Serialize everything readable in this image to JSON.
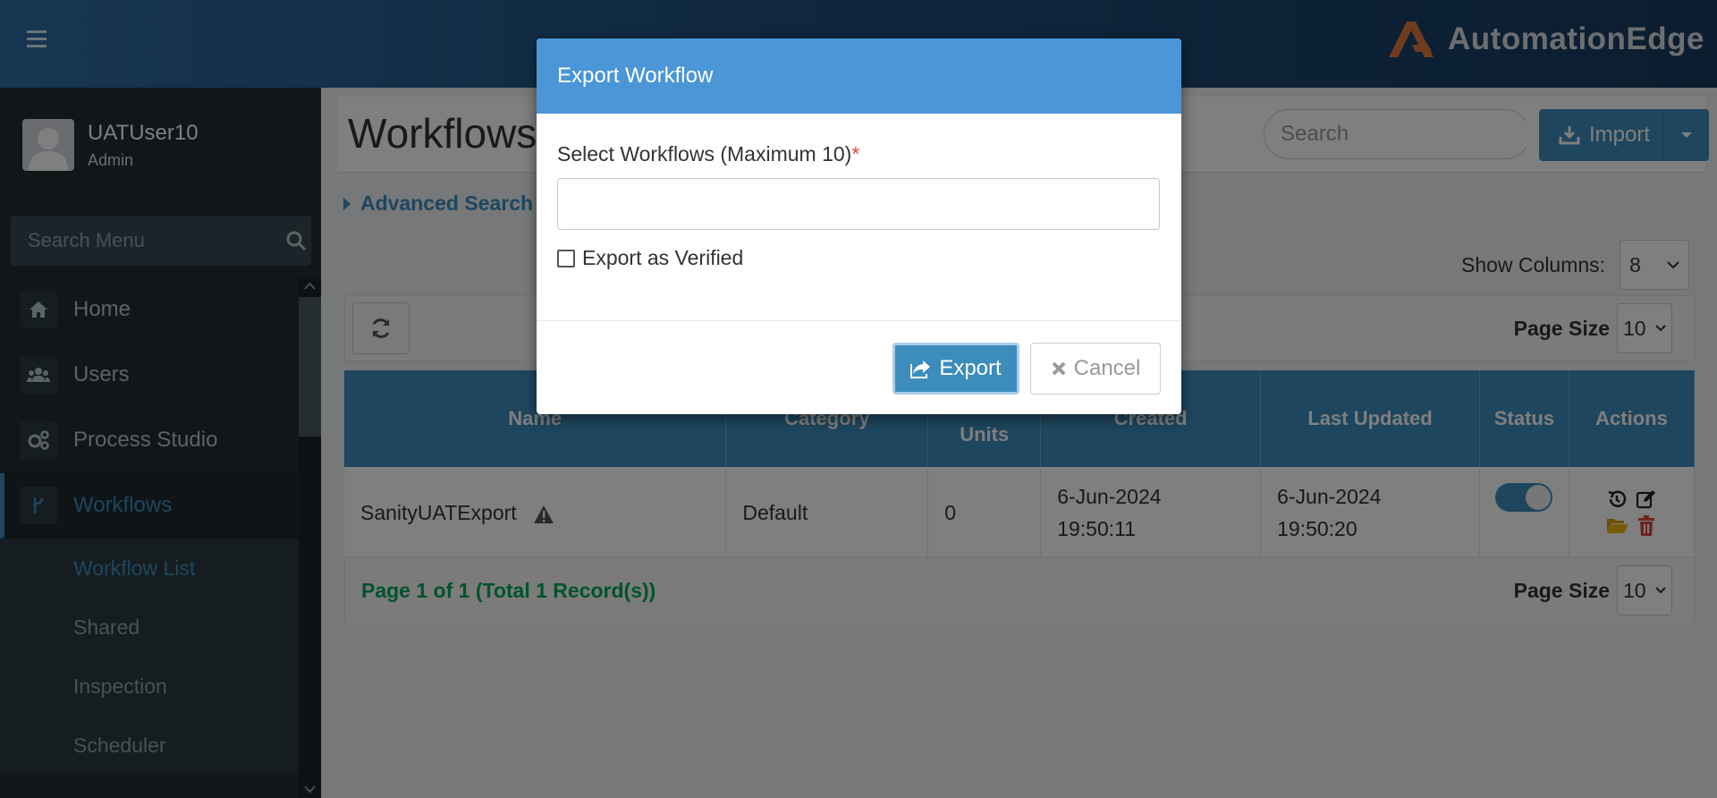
{
  "header": {
    "brand": "AutomationEdge"
  },
  "sidebar": {
    "user_name": "UATUser10",
    "user_role": "Admin",
    "search_placeholder": "Search Menu",
    "items": [
      {
        "label": "Home",
        "icon": "home-icon"
      },
      {
        "label": "Users",
        "icon": "users-icon"
      },
      {
        "label": "Process Studio",
        "icon": "gears-icon"
      },
      {
        "label": "Workflows",
        "icon": "workflow-icon"
      }
    ],
    "subitems": [
      {
        "label": "Workflow List"
      },
      {
        "label": "Shared"
      },
      {
        "label": "Inspection"
      },
      {
        "label": "Scheduler"
      }
    ]
  },
  "page": {
    "title": "Workflows",
    "search_placeholder": "Search",
    "import_label": "Import",
    "advanced_search": "Advanced Search",
    "show_columns_label": "Show Columns:",
    "show_columns_value": "8",
    "page_size_label": "Page Size",
    "page_size_value": "10"
  },
  "table": {
    "columns": [
      "Name",
      "Category",
      "Units",
      "Created",
      "Last Updated",
      "Status",
      "Actions"
    ],
    "rows": [
      {
        "name": "SanityUATExport",
        "category": "Default",
        "units": "0",
        "created_date": "6-Jun-2024",
        "created_time": "19:50:11",
        "updated_date": "6-Jun-2024",
        "updated_time": "19:50:20",
        "status_enabled": true
      }
    ],
    "page_info": "Page 1 of 1 (Total 1 Record(s))"
  },
  "modal": {
    "title": "Export Workflow",
    "select_label": "Select Workflows (Maximum 10)",
    "required_mark": "*",
    "workflows_value": "",
    "export_verified_label": "Export as Verified",
    "export_label": "Export",
    "cancel_label": "Cancel"
  },
  "colors": {
    "primary": "#3c8dbc",
    "modal_header": "#4a96d6",
    "success_text": "#00a65a",
    "danger": "#dd4b39"
  }
}
